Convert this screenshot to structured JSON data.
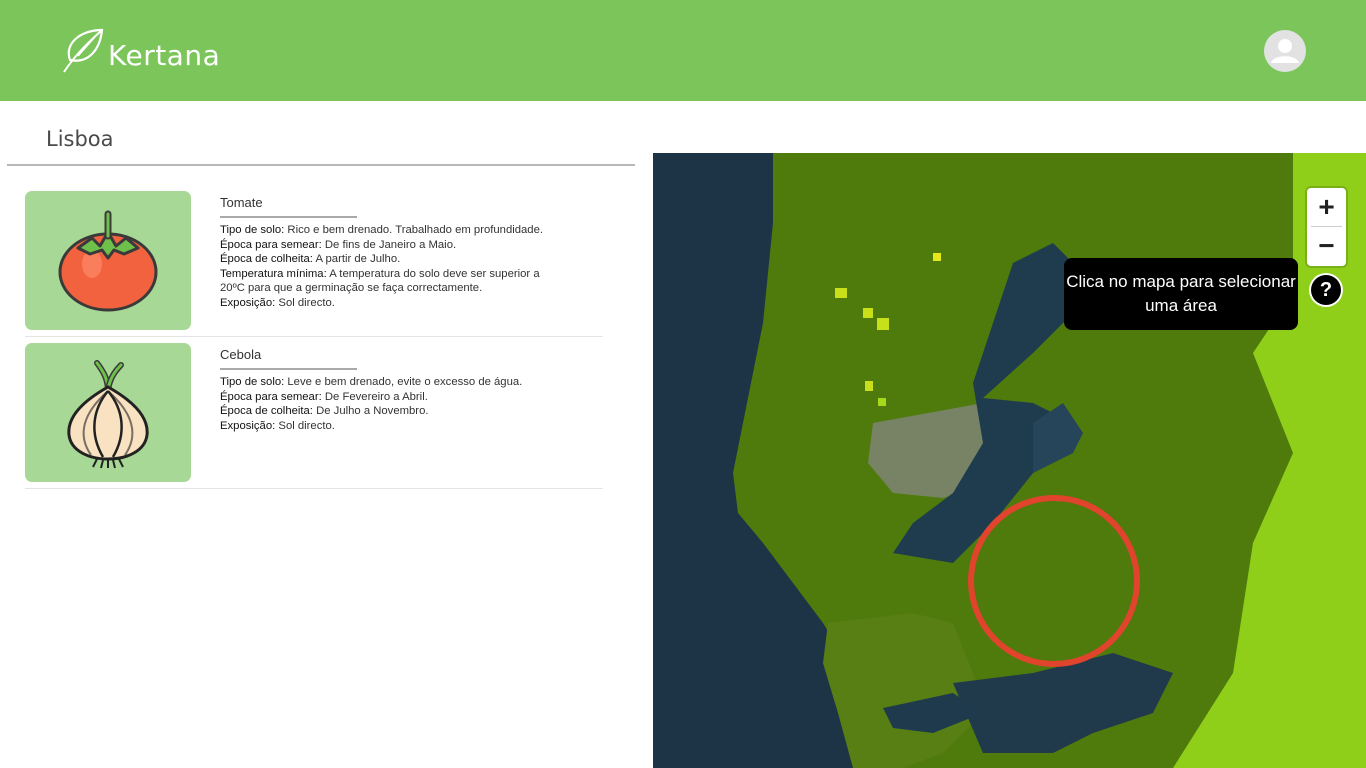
{
  "header": {
    "brand": "Kertana",
    "brand_color": "#7bc55a"
  },
  "page": {
    "city": "Lisboa"
  },
  "crops": [
    {
      "name": "Tomate",
      "icon": "tomato-icon",
      "info": [
        {
          "label": "Tipo de solo:",
          "value": " Rico e bem drenado. Trabalhado em profundidade."
        },
        {
          "label": "Época para semear:",
          "value": " De fins de Janeiro a Maio."
        },
        {
          "label": "Época de colheita:",
          "value": " A partir de Julho."
        },
        {
          "label": "Temperatura mínima:",
          "value": " A temperatura do solo deve ser superior a 20ºC para que a germinação se faça correctamente."
        },
        {
          "label": "Exposição:",
          "value": " Sol directo."
        }
      ]
    },
    {
      "name": "Cebola",
      "icon": "onion-icon",
      "info": [
        {
          "label": "Tipo de solo:",
          "value": " Leve e bem drenado, evite o excesso de água."
        },
        {
          "label": "Época para semear:",
          "value": " De Fevereiro a Abril."
        },
        {
          "label": "Época de colheita:",
          "value": " De Julho a Novembro."
        },
        {
          "label": "Exposição:",
          "value": " Sol directo."
        }
      ]
    }
  ],
  "map": {
    "zoom_in": "+",
    "zoom_out": "−",
    "tooltip": "Clica no mapa para selecionar uma área",
    "help": "?",
    "selection_color": "#e0442c"
  }
}
